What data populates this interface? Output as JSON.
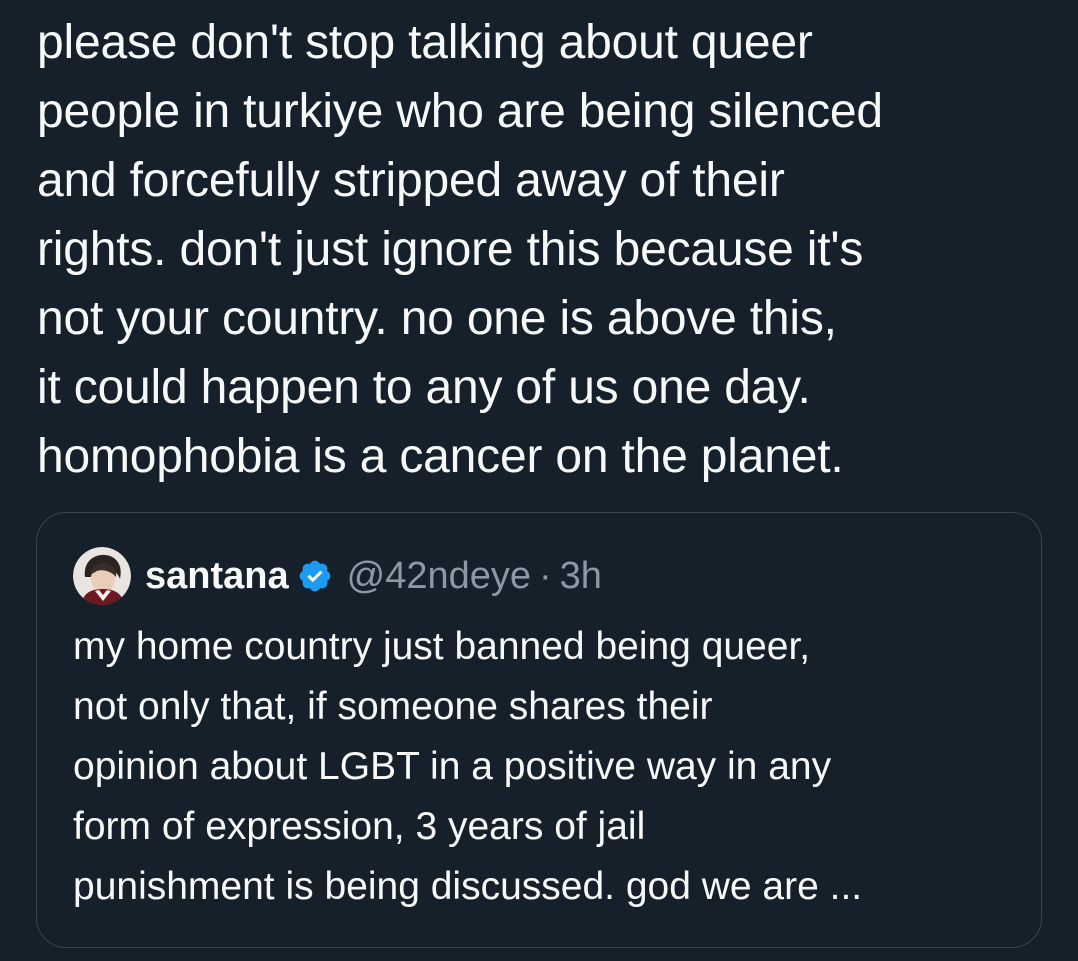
{
  "tweet": {
    "lines": [
      "please don't stop talking about queer",
      "people in turkiye who are being silenced",
      "and forcefully stripped away of their",
      "rights. don't just ignore this because it's",
      "not your country. no one is above this,",
      "it could happen to any of us one day.",
      "homophobia is a cancer on the planet."
    ]
  },
  "quote": {
    "display_name": "santana",
    "handle": "@42ndeye",
    "separator": "·",
    "time": "3h",
    "verified": true,
    "lines": [
      "my home country just banned being queer,",
      "not only that, if someone shares their",
      "opinion about LGBT in a positive way in any",
      "form of expression, 3 years of jail",
      "punishment is being discussed. god we are ..."
    ]
  },
  "colors": {
    "background": "#15202b",
    "text": "#f7f9f9",
    "secondary_text": "#8b98a5",
    "border": "#38444d",
    "verified_blue": "#1d9bf0"
  },
  "icons": {
    "verified": "verified-badge-icon",
    "avatar": "user-avatar"
  }
}
